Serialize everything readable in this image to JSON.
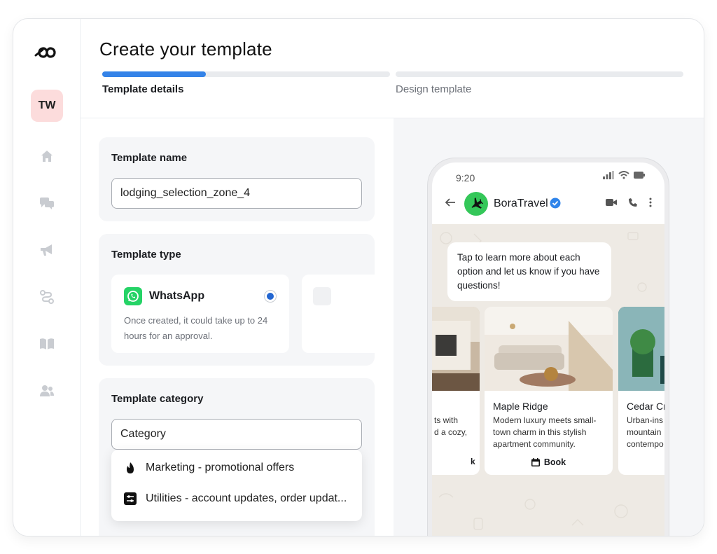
{
  "sidebar": {
    "avatar_initials": "TW",
    "logo_icon": "infinity-logo-icon",
    "nav_icons": [
      "home-icon",
      "chat-icon",
      "megaphone-icon",
      "flow-icon",
      "book-icon",
      "users-icon"
    ]
  },
  "header": {
    "title": "Create your template",
    "steps": [
      {
        "label": "Template details",
        "progress": 0.36
      },
      {
        "label": "Design template",
        "progress": 0
      }
    ]
  },
  "form": {
    "name_section": {
      "title": "Template name",
      "value": "lodging_selection_zone_4"
    },
    "type_section": {
      "title": "Template type",
      "options": [
        {
          "name": "WhatsApp",
          "description": "Once created, it could take up to 24 hours for an approval.",
          "selected": true
        }
      ]
    },
    "category_section": {
      "title": "Template category",
      "placeholder": "Category",
      "options": [
        {
          "icon": "flame-icon",
          "label": "Marketing - promotional offers"
        },
        {
          "icon": "sliders-icon",
          "label": "Utilities - account updates, order updat..."
        }
      ]
    }
  },
  "preview": {
    "status_time": "9:20",
    "contact_name": "BoraTravel",
    "message": "Tap to learn more about each option and let us know if you have questions!",
    "cards": [
      {
        "title": "",
        "description": "ts with\nd a cozy,",
        "button": ""
      },
      {
        "title": "Maple Ridge",
        "description": "Modern luxury meets small-town charm in this stylish apartment community.",
        "button": "Book"
      },
      {
        "title": "Cedar Cr",
        "description": "Urban-ins\nmountain\ncontempo",
        "button": ""
      }
    ]
  },
  "colors": {
    "accent": "#3483e8",
    "whatsapp": "#25d366",
    "avatar_bg": "#fcdcdc"
  }
}
